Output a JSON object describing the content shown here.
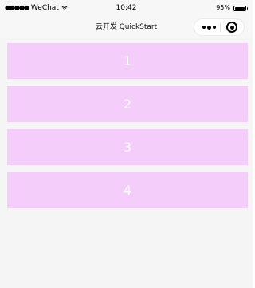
{
  "status_bar": {
    "signal": "●●●●●",
    "carrier": "WeChat",
    "time": "10:42",
    "battery_percent": "95%",
    "battery_level": 0.95
  },
  "nav": {
    "title": "云开发 QuickStart"
  },
  "cards": [
    {
      "label": "1"
    },
    {
      "label": "2"
    },
    {
      "label": "3"
    },
    {
      "label": "4"
    }
  ],
  "colors": {
    "card_bg": "#f4cdfa",
    "card_text": "#ffffff",
    "nav_bg": "#f7f7f7"
  },
  "icons": {
    "more": "more-dots-icon",
    "close": "capsule-close-icon",
    "wifi": "wifi-icon",
    "battery": "battery-icon"
  }
}
